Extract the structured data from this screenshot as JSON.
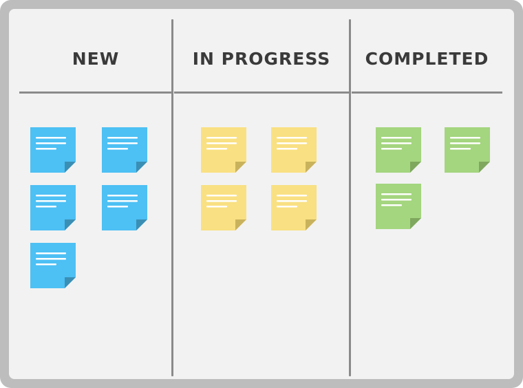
{
  "board": {
    "columns": [
      {
        "title": "NEW",
        "note_color": "#4dc0f4",
        "fold_color": "#3a8fb5",
        "note_count": 5
      },
      {
        "title": "IN PROGRESS",
        "note_color": "#f9e082",
        "fold_color": "#c9b25c",
        "note_count": 4
      },
      {
        "title": "COMPLETED",
        "note_color": "#a4d57f",
        "fold_color": "#7fa85e",
        "note_count": 3
      }
    ]
  },
  "colors": {
    "frame": "#bdbdbd",
    "board": "#f2f2f2",
    "divider": "#8a8a8a",
    "title_text": "#3a3a3a",
    "note_lines": "#ffffff"
  }
}
